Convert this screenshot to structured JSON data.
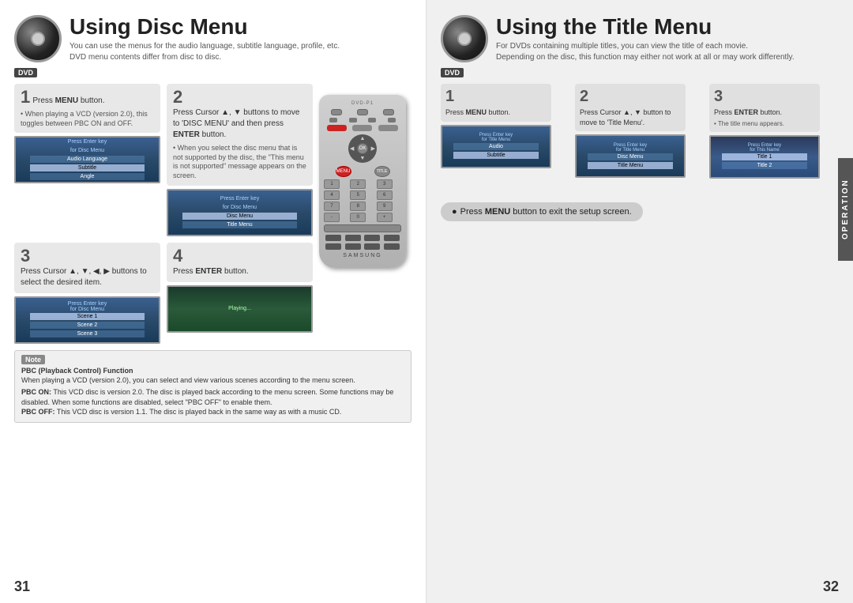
{
  "left_page": {
    "title": "Using Disc Menu",
    "subtitle1": "You can use the menus for the audio language, subtitle language, profile, etc.",
    "subtitle2": "DVD menu contents differ from disc to disc.",
    "dvd_badge": "DVD",
    "steps": [
      {
        "number": "1",
        "text": "Press MENU button.",
        "bullet": "• When playing a VCD (version 2.0), this toggles between PBC ON and OFF."
      },
      {
        "number": "2",
        "text": "Press Cursor ▲, ▼ buttons to move to 'DISC MENU' and then press ENTER button.",
        "bullet": "• When you select the disc menu that is not supported by the disc, the \"This menu is not supported\" message appears on the screen."
      },
      {
        "number": "3",
        "text": "Press Cursor ▲, ▼, ◀, ▶ buttons to select the desired item.",
        "bullet": ""
      },
      {
        "number": "4",
        "text": "Press ENTER button.",
        "bullet": ""
      }
    ],
    "note": {
      "title": "Note",
      "pbc_title": "PBC (Playback Control) Function",
      "pbc_desc": "When playing a VCD (version 2.0), you can select and view various scenes according to the menu screen.",
      "pbc_on": "PBC ON: This VCD disc is version 2.0. The disc is played back according to the menu screen. Some functions may be disabled. When some functions are disabled, select \"PBC OFF\" to enable them.",
      "pbc_off": "PBC OFF: This VCD disc is version 1.1. The disc is played back in the same way as with a music CD."
    },
    "page_number": "31"
  },
  "right_page": {
    "title": "Using the Title Menu",
    "subtitle1": "For DVDs containing multiple titles, you can view the title of each movie.",
    "subtitle2": "Depending on the disc, this function may either not work at all or may work differently.",
    "dvd_badge": "DVD",
    "steps": [
      {
        "number": "1",
        "text": "Press MENU button."
      },
      {
        "number": "2",
        "text": "Press Cursor ▲, ▼ button to move to 'Title Menu'."
      },
      {
        "number": "3",
        "text": "Press ENTER button.",
        "bullet": "• The title menu appears."
      }
    ],
    "exit_note": "Press MENU button to exit the setup screen.",
    "operation_label": "OPERATION",
    "page_number": "32"
  }
}
